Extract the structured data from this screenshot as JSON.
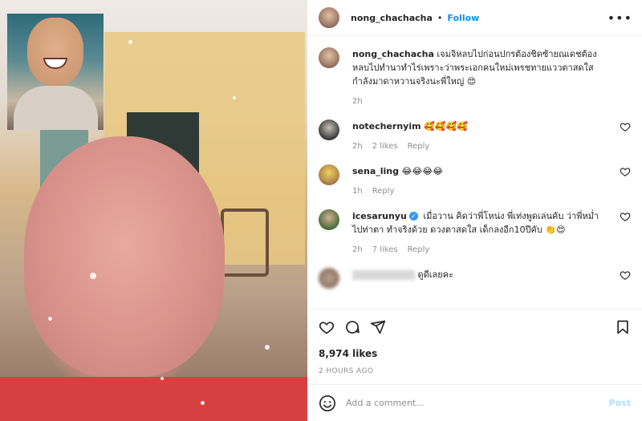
{
  "header": {
    "username": "nong_chachacha",
    "separator": "•",
    "follow_label": "Follow",
    "more_icon": "more-horizontal-icon"
  },
  "caption": {
    "username": "nong_chachacha",
    "text": "เจมจิหลบไปก่อนปกรต้องชิดซ้ายณเดชต้องหลบไปทำนาทำไร่เพราะว่าพระเอกคนใหม่เพรชทายแววตาสดใสกำลังมาดาหวานจริงนะพี่ใหญ่ 😍",
    "time": "2h"
  },
  "comments": [
    {
      "username": "notechernyim",
      "text": "🥰🥰🥰🥰",
      "time": "2h",
      "likes": "2 likes",
      "reply": "Reply",
      "verified": false
    },
    {
      "username": "sena_ling",
      "text": "😂😂😂😂",
      "time": "1h",
      "likes": "",
      "reply": "Reply",
      "verified": false
    },
    {
      "username": "icesarunyu",
      "text": "เมื่อวาน คิดว่าพี่โหน่ง พี่เท่งพูดเล่นคับ ว่าพี่หม่ำ ไปท่าตา ทำจริงด้วย ดวงตาสดใส เด็กลงอีก10ปีคับ 👏😍",
      "time": "2h",
      "likes": "7 likes",
      "reply": "Reply",
      "verified": true
    },
    {
      "username": "",
      "text": "ดูดีเลยคะ",
      "time": "",
      "likes": "",
      "reply": "",
      "verified": false
    }
  ],
  "actions": {
    "like_icon": "heart-icon",
    "comment_icon": "comment-icon",
    "share_icon": "send-icon",
    "save_icon": "bookmark-icon",
    "likes_count": "8,974 likes",
    "timestamp": "2 HOURS AGO"
  },
  "add_comment": {
    "emoji_icon": "emoji-icon",
    "placeholder": "Add a comment...",
    "post_label": "Post"
  },
  "colors": {
    "accent": "#0095f6",
    "post_disabled": "#b2dffc",
    "muted": "#8e8e8e"
  }
}
